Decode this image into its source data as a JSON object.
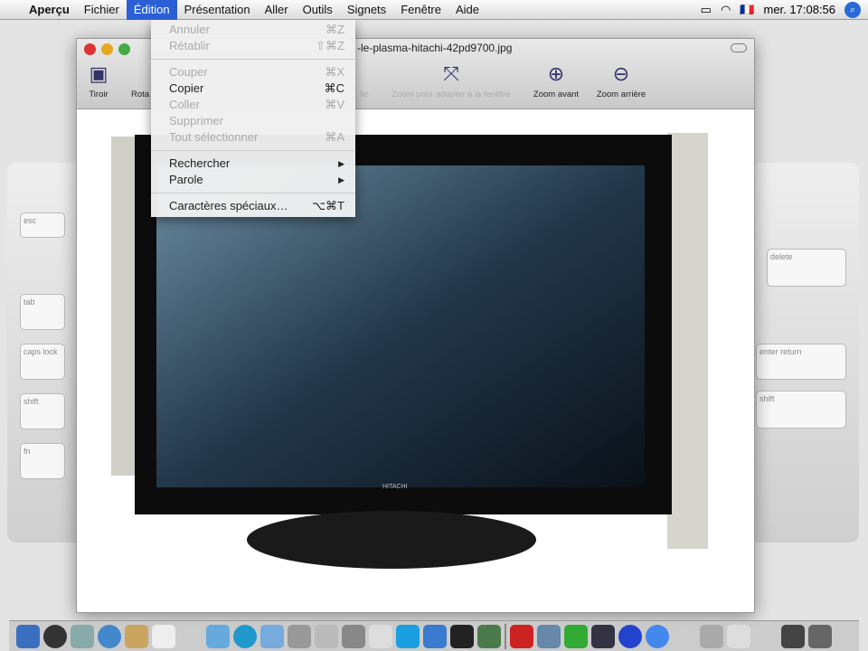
{
  "menubar": {
    "apple": "",
    "app": "Aperçu",
    "items": [
      "Fichier",
      "Édition",
      "Présentation",
      "Aller",
      "Outils",
      "Signets",
      "Fenêtre",
      "Aide"
    ],
    "flag": "🇫🇷",
    "clock": "mer. 17:08:56"
  },
  "window": {
    "title": "-le-plasma-hitachi-42pd9700.jpg",
    "toolbar": [
      {
        "label": "Tiroir"
      },
      {
        "label": "Rota"
      },
      {
        "label": "lle"
      },
      {
        "label": "Zoom pour adapter à la fenêtre"
      },
      {
        "label": "Zoom avant"
      },
      {
        "label": "Zoom arrière"
      }
    ],
    "tv_brand": "HITACHI"
  },
  "edit_menu": {
    "items": [
      {
        "label": "Annuler",
        "shortcut": "⌘Z",
        "enabled": false
      },
      {
        "label": "Rétablir",
        "shortcut": "⇧⌘Z",
        "enabled": false
      },
      {
        "label": "Couper",
        "shortcut": "⌘X",
        "enabled": false
      },
      {
        "label": "Copier",
        "shortcut": "⌘C",
        "enabled": true
      },
      {
        "label": "Coller",
        "shortcut": "⌘V",
        "enabled": false
      },
      {
        "label": "Supprimer",
        "shortcut": "",
        "enabled": false
      },
      {
        "label": "Tout sélectionner",
        "shortcut": "⌘A",
        "enabled": false
      },
      {
        "label": "Rechercher",
        "shortcut": "▶",
        "enabled": true
      },
      {
        "label": "Parole",
        "shortcut": "▶",
        "enabled": true
      },
      {
        "label": "Caractères spéciaux…",
        "shortcut": "⌥⌘T",
        "enabled": true
      }
    ]
  },
  "keyboard_keys": {
    "left": [
      "esc",
      "tab",
      "caps lock",
      "shift",
      "fn"
    ],
    "right": [
      "delete",
      "enter",
      "return",
      "shift"
    ]
  }
}
